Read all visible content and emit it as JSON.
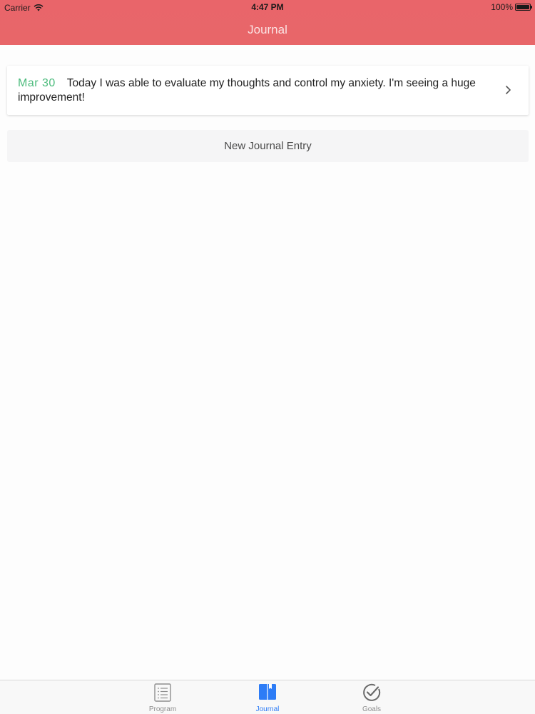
{
  "status_bar": {
    "carrier": "Carrier",
    "time": "4:47 PM",
    "battery": "100%",
    "battery_level": 1.0
  },
  "header": {
    "title": "Journal",
    "background_color": "#e8666a"
  },
  "entries": [
    {
      "date": "Mar 30",
      "text": "Today I was able to evaluate my thoughts and control my anxiety. I'm seeing a huge improvement!",
      "icon": "chevron-right-icon"
    }
  ],
  "new_entry_button": {
    "label": "New Journal Entry"
  },
  "tab_bar": {
    "tabs": [
      {
        "label": "Program",
        "icon": "list-icon",
        "active": false
      },
      {
        "label": "Journal",
        "icon": "book-icon",
        "active": true
      },
      {
        "label": "Goals",
        "icon": "checkmark-circle-icon",
        "active": false
      }
    ],
    "active_color": "#2d7cf6",
    "inactive_color": "#8e8e8e"
  },
  "colors": {
    "date_green": "#4bbb7c"
  }
}
